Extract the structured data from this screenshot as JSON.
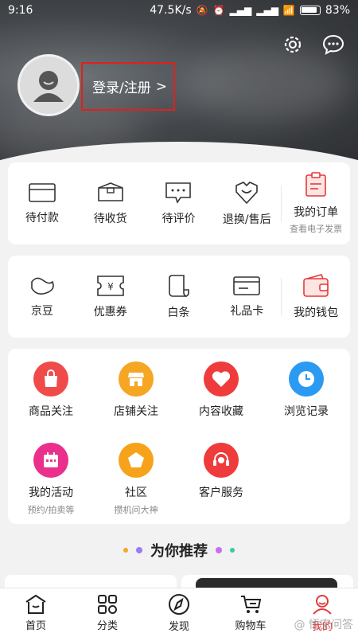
{
  "status": {
    "time": "9:16",
    "speed": "47.5K/s",
    "battery": "83%"
  },
  "header": {
    "login_label": "登录/注册",
    "login_arrow": ">"
  },
  "orders": {
    "items": [
      {
        "label": "待付款",
        "icon": "wallet-card-icon"
      },
      {
        "label": "待收货",
        "icon": "box-icon"
      },
      {
        "label": "待评价",
        "icon": "comment-icon"
      },
      {
        "label": "退换/售后",
        "icon": "service-icon"
      }
    ],
    "my_orders": {
      "label": "我的订单",
      "sub": "查看电子发票",
      "icon": "clipboard-icon"
    }
  },
  "assets": {
    "items": [
      {
        "label": "京豆",
        "icon": "bean-icon"
      },
      {
        "label": "优惠券",
        "icon": "coupon-icon"
      },
      {
        "label": "白条",
        "icon": "scroll-icon"
      },
      {
        "label": "礼品卡",
        "icon": "gift-card-icon"
      }
    ],
    "wallet": {
      "label": "我的钱包",
      "icon": "wallet-icon"
    }
  },
  "services": [
    {
      "label": "商品关注",
      "sub": "",
      "icon": "shopping-bag-icon",
      "color": "#f04a4a"
    },
    {
      "label": "店铺关注",
      "sub": "",
      "icon": "shop-icon",
      "color": "#f5a623"
    },
    {
      "label": "内容收藏",
      "sub": "",
      "icon": "heart-icon",
      "color": "#ef3b3b"
    },
    {
      "label": "浏览记录",
      "sub": "",
      "icon": "clock-icon",
      "color": "#2b9af3"
    },
    {
      "label": "我的活动",
      "sub": "预约/拍卖等",
      "icon": "calendar-icon",
      "color": "#ea2f8c"
    },
    {
      "label": "社区",
      "sub": "攒机问大神",
      "icon": "pentagon-icon",
      "color": "#f7a21b"
    },
    {
      "label": "客户服务",
      "sub": "",
      "icon": "headset-icon",
      "color": "#ef3b3b"
    }
  ],
  "recommend": {
    "title": "为你推荐"
  },
  "tabs": [
    {
      "label": "首页",
      "icon": "home-icon"
    },
    {
      "label": "分类",
      "icon": "category-icon"
    },
    {
      "label": "发现",
      "icon": "compass-icon"
    },
    {
      "label": "购物车",
      "icon": "cart-icon"
    },
    {
      "label": "我的",
      "icon": "user-icon"
    }
  ],
  "watermark": "@ 悟空问答",
  "colors": {
    "accent": "#e4393c",
    "highlight_box": "#e02020"
  }
}
